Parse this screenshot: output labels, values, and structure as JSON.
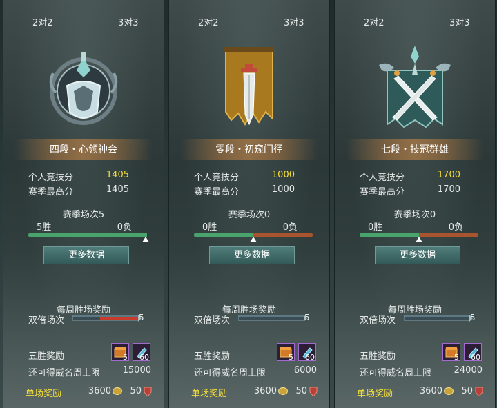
{
  "panels": [
    {
      "tab_left": "2对2",
      "tab_right": "3对3",
      "rank": "四段・心领神会",
      "score_label": "个人竞技分",
      "score_value": "1405",
      "best_label": "赛季最高分",
      "best_value": "1405",
      "season_count": "赛季场次5",
      "wins": "5胜",
      "losses": "0负",
      "win_fraction": 1.0,
      "more_label": "更多数据",
      "weekly_title": "每周胜场奖励",
      "double_label": "双倍场次",
      "double_count": "5",
      "five_win_label": "五胜奖励",
      "reward1_count": "5",
      "reward2_count": "60",
      "limit_label": "还可得威名周上限",
      "limit_value": "15000",
      "single_label": "单场奖励",
      "single_coin": "3600",
      "single_other": "50",
      "emblem": "tier-4-emblem"
    },
    {
      "tab_left": "2对2",
      "tab_right": "3对3",
      "rank": "零段・初窥门径",
      "score_label": "个人竞技分",
      "score_value": "1000",
      "best_label": "赛季最高分",
      "best_value": "1000",
      "season_count": "赛季场次0",
      "wins": "0胜",
      "losses": "0负",
      "win_fraction": 0.5,
      "more_label": "更多数据",
      "weekly_title": "每周胜场奖励",
      "double_label": "双倍场次",
      "double_count": "5",
      "five_win_label": "五胜奖励",
      "reward1_count": "5",
      "reward2_count": "60",
      "limit_label": "还可得威名周上限",
      "limit_value": "6000",
      "single_label": "单场奖励",
      "single_coin": "3600",
      "single_other": "50",
      "emblem": "tier-0-banner-emblem"
    },
    {
      "tab_left": "2对2",
      "tab_right": "3对3",
      "rank": "七段・技冠群雄",
      "score_label": "个人竞技分",
      "score_value": "1700",
      "best_label": "赛季最高分",
      "best_value": "1700",
      "season_count": "赛季场次0",
      "wins": "0胜",
      "losses": "0负",
      "win_fraction": 0.5,
      "more_label": "更多数据",
      "weekly_title": "每周胜场奖励",
      "double_label": "双倍场次",
      "double_count": "5",
      "five_win_label": "五胜奖励",
      "reward1_count": "5",
      "reward2_count": "60",
      "limit_label": "还可得威名周上限",
      "limit_value": "24000",
      "single_label": "单场奖励",
      "single_coin": "3600",
      "single_other": "50",
      "emblem": "tier-7-swords-emblem"
    }
  ],
  "colors": {
    "highlight_score": "#f3de3a",
    "win_bar": "#49a36c",
    "loss_bar": "#a8542f"
  }
}
